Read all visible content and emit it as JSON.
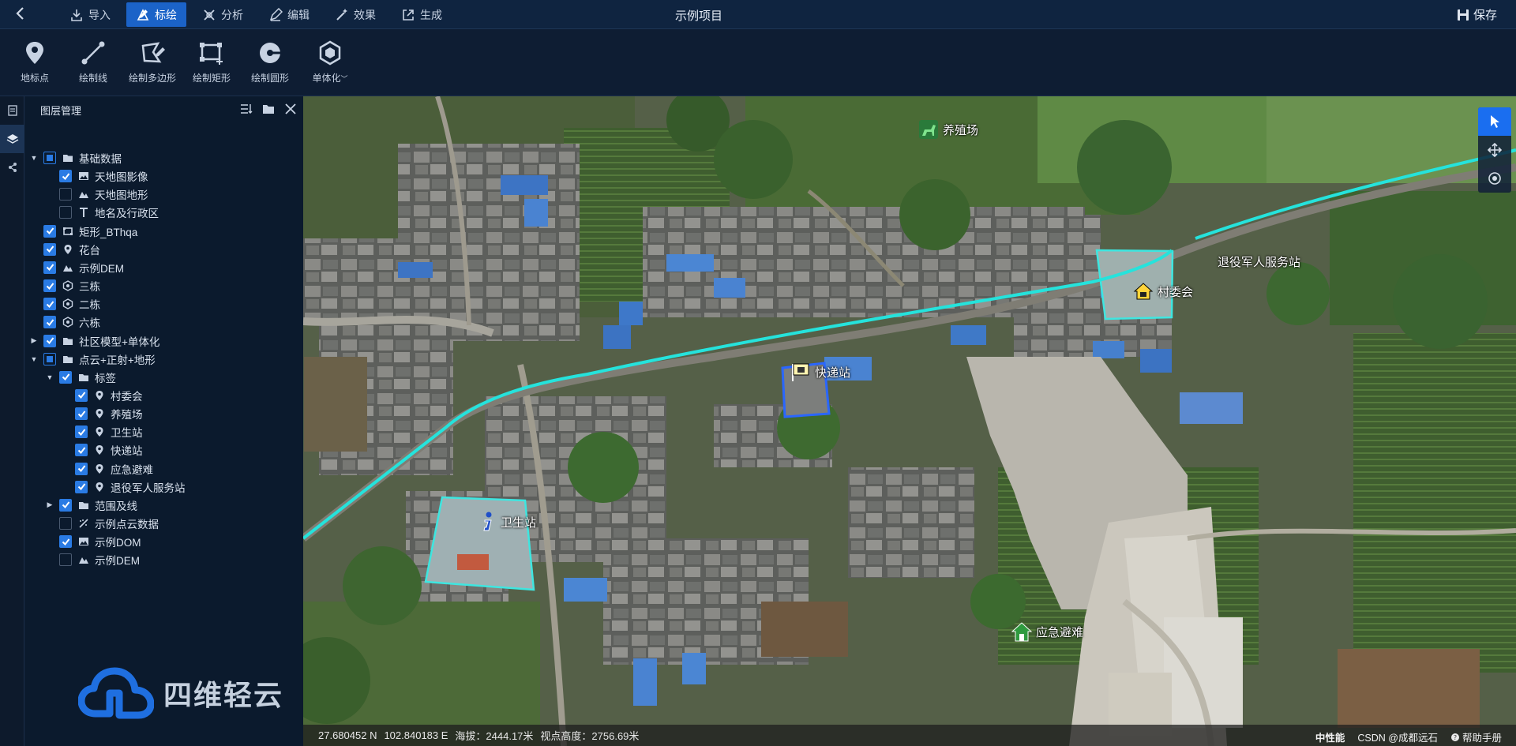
{
  "header": {
    "title": "示例项目",
    "save_label": "保存",
    "tabs": [
      {
        "label": "导入",
        "icon": "import-icon"
      },
      {
        "label": "标绘",
        "icon": "plot-icon"
      },
      {
        "label": "分析",
        "icon": "analysis-icon"
      },
      {
        "label": "编辑",
        "icon": "edit-icon"
      },
      {
        "label": "效果",
        "icon": "effect-icon"
      },
      {
        "label": "生成",
        "icon": "export-icon"
      }
    ],
    "active_tab": "标绘"
  },
  "toolbar": {
    "tools": [
      {
        "label": "地标点",
        "icon": "placemark-icon"
      },
      {
        "label": "绘制线",
        "icon": "polyline-icon"
      },
      {
        "label": "绘制多边形",
        "icon": "polygon-icon"
      },
      {
        "label": "绘制矩形",
        "icon": "rectangle-icon"
      },
      {
        "label": "绘制圆形",
        "icon": "circle-icon"
      },
      {
        "label": "单体化",
        "icon": "hexagon-icon"
      }
    ]
  },
  "layer_panel": {
    "title": "图层管理",
    "items": [
      {
        "label": "基础数据",
        "level": 0,
        "expanded": true,
        "check": "part",
        "icon": "folder-icon"
      },
      {
        "label": "天地图影像",
        "level": 1,
        "check": "on",
        "icon": "image-icon"
      },
      {
        "label": "天地图地形",
        "level": 1,
        "check": "off",
        "icon": "terrain-icon"
      },
      {
        "label": "地名及行政区",
        "level": 1,
        "check": "off",
        "icon": "text-icon"
      },
      {
        "label": "矩形_BThqa",
        "level": 0,
        "check": "on",
        "icon": "rectangle-icon"
      },
      {
        "label": "花台",
        "level": 0,
        "check": "on",
        "icon": "placemark-icon"
      },
      {
        "label": "示例DEM",
        "level": 0,
        "check": "on",
        "icon": "terrain-icon"
      },
      {
        "label": "三栋",
        "level": 0,
        "check": "on",
        "icon": "hexagon-icon"
      },
      {
        "label": "二栋",
        "level": 0,
        "check": "on",
        "icon": "hexagon-icon"
      },
      {
        "label": "六栋",
        "level": 0,
        "check": "on",
        "icon": "hexagon-icon"
      },
      {
        "label": "社区模型+单体化",
        "level": 0,
        "expanded": false,
        "check": "on",
        "icon": "folder-icon"
      },
      {
        "label": "点云+正射+地形",
        "level": 0,
        "expanded": true,
        "check": "part",
        "icon": "folder-icon"
      },
      {
        "label": "标签",
        "level": 1,
        "expanded": true,
        "check": "on",
        "icon": "folder-icon"
      },
      {
        "label": "村委会",
        "level": 2,
        "check": "on",
        "icon": "placemark-icon"
      },
      {
        "label": "养殖场",
        "level": 2,
        "check": "on",
        "icon": "placemark-icon"
      },
      {
        "label": "卫生站",
        "level": 2,
        "check": "on",
        "icon": "placemark-icon"
      },
      {
        "label": "快递站",
        "level": 2,
        "check": "on",
        "icon": "placemark-icon"
      },
      {
        "label": "应急避难",
        "level": 2,
        "check": "on",
        "icon": "placemark-icon"
      },
      {
        "label": "退役军人服务站",
        "level": 2,
        "check": "on",
        "icon": "placemark-icon"
      },
      {
        "label": "范围及线",
        "level": 1,
        "expanded": false,
        "check": "on",
        "icon": "folder-icon"
      },
      {
        "label": "示例点云数据",
        "level": 1,
        "check": "off",
        "icon": "pointcloud-icon"
      },
      {
        "label": "示例DOM",
        "level": 1,
        "check": "on",
        "icon": "image-icon"
      },
      {
        "label": "示例DEM",
        "level": 1,
        "check": "off",
        "icon": "terrain-icon"
      }
    ]
  },
  "brand": {
    "logo_text": "四维轻云"
  },
  "map": {
    "labels": [
      {
        "text": "养殖场",
        "icon": "horse-icon"
      },
      {
        "text": "村委会",
        "icon": "house-icon"
      },
      {
        "text": "退役军人服务站",
        "icon": ""
      },
      {
        "text": "快递站",
        "icon": "post-icon"
      },
      {
        "text": "卫生站",
        "icon": "info-icon"
      },
      {
        "text": "应急避难",
        "icon": "shelter-icon"
      }
    ],
    "colors": {
      "route": "#25e3dc",
      "area_outline": "#3ee6e0",
      "selected_outline": "#2a66ff",
      "accent": "#1b63c8"
    }
  },
  "status": {
    "lat": "27.680452 N",
    "lon": "102.840183 E",
    "altitude": "海拔：2444.17米",
    "view_height": "视点高度：2756.69米",
    "performance": "中性能",
    "help": "帮助手册",
    "watermark": "CSDN @成都远石"
  }
}
